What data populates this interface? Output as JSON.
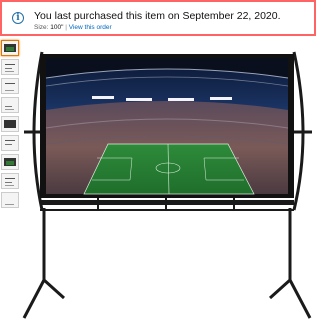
{
  "notice": {
    "icon": "info-icon",
    "message": "You last purchased this item on September 22, 2020.",
    "size_label": "Size:",
    "size_value": "100\"",
    "separator": "|",
    "view_order_link": "View this order"
  },
  "thumbnails": {
    "count_visible": 9,
    "selected_index": 0
  },
  "product_image": {
    "subject": "projector-screen-with-stand",
    "screen_border_color": "#111111",
    "field_color": "#2e8b3a"
  }
}
